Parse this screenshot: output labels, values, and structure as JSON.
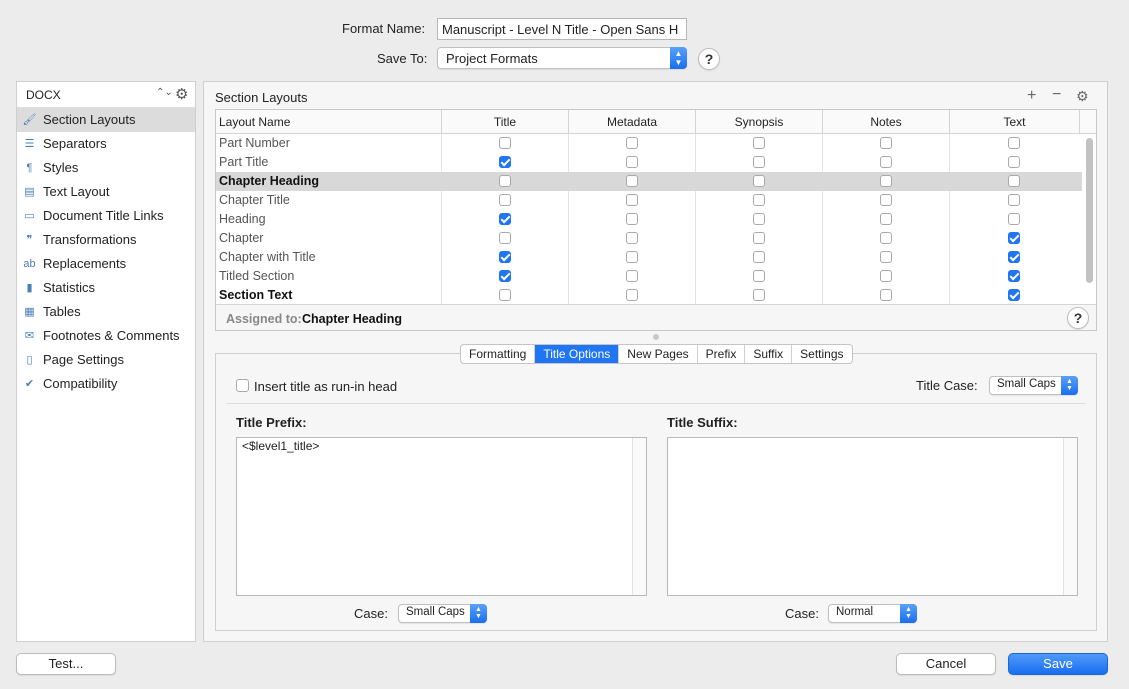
{
  "header": {
    "format_name_label": "Format Name:",
    "format_name_value": "Manuscript - Level N Title - Open Sans H",
    "save_to_label": "Save To:",
    "save_to_value": "Project Formats",
    "help_label": "?"
  },
  "sidebar": {
    "format_type": "DOCX",
    "items": [
      {
        "label": "Section Layouts",
        "icon": "brush-icon"
      },
      {
        "label": "Separators",
        "icon": "separators-icon"
      },
      {
        "label": "Styles",
        "icon": "styles-icon"
      },
      {
        "label": "Text Layout",
        "icon": "text-layout-icon"
      },
      {
        "label": "Document Title Links",
        "icon": "document-icon"
      },
      {
        "label": "Transformations",
        "icon": "quotes-icon"
      },
      {
        "label": "Replacements",
        "icon": "replace-icon"
      },
      {
        "label": "Statistics",
        "icon": "bar-chart-icon"
      },
      {
        "label": "Tables",
        "icon": "table-icon"
      },
      {
        "label": "Footnotes & Comments",
        "icon": "note-icon"
      },
      {
        "label": "Page Settings",
        "icon": "page-icon"
      },
      {
        "label": "Compatibility",
        "icon": "check-doc-icon"
      }
    ]
  },
  "section_layouts": {
    "title": "Section Layouts",
    "columns": [
      "Layout Name",
      "Title",
      "Metadata",
      "Synopsis",
      "Notes",
      "Text"
    ],
    "rows": [
      {
        "name": "Part Number",
        "bold": false,
        "checks": [
          false,
          false,
          false,
          false,
          false
        ]
      },
      {
        "name": "Part Title",
        "bold": false,
        "checks": [
          true,
          false,
          false,
          false,
          false
        ]
      },
      {
        "name": "Chapter Heading",
        "bold": true,
        "checks": [
          false,
          false,
          false,
          false,
          false
        ]
      },
      {
        "name": "Chapter Title",
        "bold": false,
        "checks": [
          false,
          false,
          false,
          false,
          false
        ]
      },
      {
        "name": "Heading",
        "bold": false,
        "checks": [
          true,
          false,
          false,
          false,
          false
        ]
      },
      {
        "name": "Chapter",
        "bold": false,
        "checks": [
          false,
          false,
          false,
          false,
          true
        ]
      },
      {
        "name": "Chapter with Title",
        "bold": false,
        "checks": [
          true,
          false,
          false,
          false,
          true
        ]
      },
      {
        "name": "Titled Section",
        "bold": false,
        "checks": [
          true,
          false,
          false,
          false,
          true
        ]
      },
      {
        "name": "Section Text",
        "bold": true,
        "checks": [
          false,
          false,
          false,
          false,
          true
        ]
      }
    ],
    "selected_row": 2,
    "assigned_label": "Assigned to:",
    "assigned_value": "Chapter Heading"
  },
  "tabs": [
    "Formatting",
    "Title Options",
    "New Pages",
    "Prefix",
    "Suffix",
    "Settings"
  ],
  "active_tab": 1,
  "title_options": {
    "run_in_label": "Insert title as run-in head",
    "run_in_checked": false,
    "title_case_label": "Title Case:",
    "title_case_value": "Small Caps",
    "prefix_label": "Title Prefix:",
    "prefix_value": "<$level1_title>",
    "suffix_label": "Title Suffix:",
    "suffix_value": "",
    "prefix_case_label": "Case:",
    "prefix_case_value": "Small Caps",
    "suffix_case_label": "Case:",
    "suffix_case_value": "Normal"
  },
  "footer": {
    "test_label": "Test...",
    "cancel_label": "Cancel",
    "save_label": "Save"
  },
  "colors": {
    "accent": "#1f75f2",
    "selection": "#d8d8d8"
  }
}
